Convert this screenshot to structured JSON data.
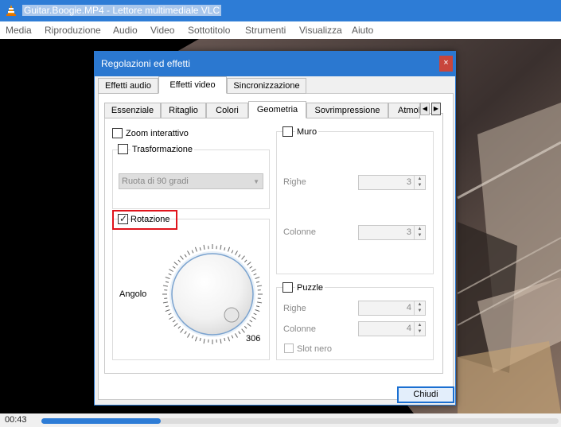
{
  "window": {
    "title": "Guitar.Boogie.MP4 - Lettore multimediale VLC"
  },
  "menu": [
    "Media",
    "Riproduzione",
    "Audio",
    "Video",
    "Sottotitolo",
    "Strumenti",
    "Visualizza",
    "Aiuto"
  ],
  "status": {
    "time": "00:43",
    "progress": 0.23
  },
  "dialog": {
    "title": "Regolazioni ed effetti",
    "close_glyph": "×",
    "tabs": [
      "Effetti audio",
      "Effetti video",
      "Sincronizzazione"
    ],
    "active_tab": "Effetti video",
    "subtabs": [
      "Essenziale",
      "Ritaglio",
      "Colori",
      "Geometria",
      "Sovrimpressione",
      "AtmoLight"
    ],
    "active_subtab": "Geometria",
    "geometry": {
      "zoom_label": "Zoom interattivo",
      "transform_label": "Trasformazione",
      "transform_select": "Ruota di 90 gradi",
      "rotation_label": "Rotazione",
      "rotation_checked": true,
      "angle_label": "Angolo",
      "angle_value": "306",
      "wall": {
        "label": "Muro",
        "rows_label": "Righe",
        "rows_value": "3",
        "cols_label": "Colonne",
        "cols_value": "3"
      },
      "puzzle": {
        "label": "Puzzle",
        "rows_label": "Righe",
        "rows_value": "4",
        "cols_label": "Colonne",
        "cols_value": "4",
        "black_slot_label": "Slot nero"
      }
    },
    "close_button": "Chiudi"
  },
  "colors": {
    "accent": "#2b78d0",
    "highlight": "#e0141c"
  }
}
